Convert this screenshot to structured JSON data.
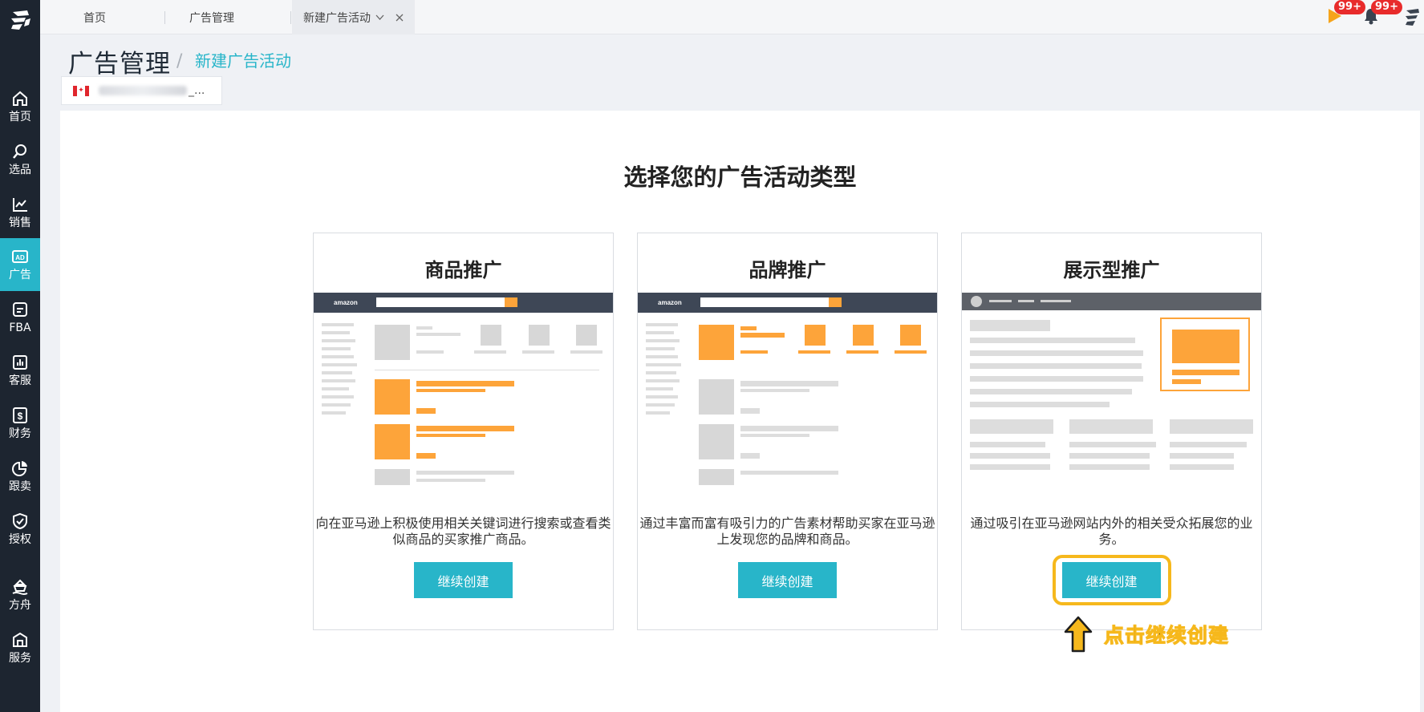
{
  "sidebar": {
    "items": [
      {
        "label": "首页",
        "icon": "home-icon"
      },
      {
        "label": "选品",
        "icon": "search-icon"
      },
      {
        "label": "销售",
        "icon": "trend-chart-icon"
      },
      {
        "label": "广告",
        "icon": "ad-icon"
      },
      {
        "label": "FBA",
        "icon": "fba-icon"
      },
      {
        "label": "客服",
        "icon": "bar-chart-icon"
      },
      {
        "label": "财务",
        "icon": "dollar-icon"
      },
      {
        "label": "跟卖",
        "icon": "pie-chart-icon"
      },
      {
        "label": "授权",
        "icon": "shield-check-icon"
      },
      {
        "label": "方舟",
        "icon": "ark-icon"
      },
      {
        "label": "服务",
        "icon": "service-icon"
      }
    ],
    "active": "广告"
  },
  "tabs": [
    {
      "label": "首页"
    },
    {
      "label": "广告管理"
    },
    {
      "label": "新建广告活动"
    }
  ],
  "notifications": {
    "flag_count": "99+",
    "bell_count": "99+"
  },
  "header": {
    "title": "广告管理",
    "breadcrumb_sep": "/",
    "breadcrumb": "新建广告活动"
  },
  "store": {
    "name_suffix": "_..."
  },
  "main": {
    "heading": "选择您的广告活动类型",
    "cards": [
      {
        "title": "商品推广",
        "description": "向在亚马逊上积极使用相关关键词进行搜索或查看类似商品的买家推广商品。",
        "button": "继续创建"
      },
      {
        "title": "品牌推广",
        "description": "通过丰富而富有吸引力的广告素材帮助买家在亚马逊上发现您的品牌和商品。",
        "button": "继续创建"
      },
      {
        "title": "展示型推广",
        "description": "通过吸引在亚马逊网站内外的相关受众拓展您的业务。",
        "button": "继续创建"
      }
    ],
    "hint": "点击继续创建"
  },
  "colors": {
    "accent": "#28b5c9",
    "sidebar_bg": "#1d2530",
    "highlight": "#f6b81c",
    "illus_orange": "#fda43a"
  }
}
